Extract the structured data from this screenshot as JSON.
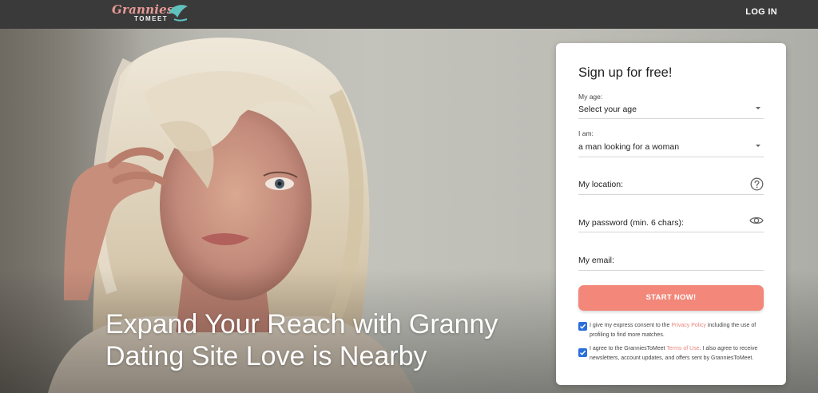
{
  "header": {
    "logo_main": "Grannies",
    "logo_sub": "TOMEET",
    "login_label": "LOG IN"
  },
  "hero": {
    "headline_line1": "Expand Your Reach with Granny",
    "headline_line2": "Dating Site Love is Nearby"
  },
  "signup": {
    "title": "Sign up for free!",
    "age_label": "My age:",
    "age_value": "Select your age",
    "iam_label": "I am:",
    "iam_value": "a man looking for a woman",
    "location_placeholder": "My location:",
    "password_placeholder": "My password (min. 6 chars):",
    "email_placeholder": "My email:",
    "submit_label": "START NOW!",
    "consent1_before": "I give my express consent to the ",
    "consent1_link": "Privacy Policy",
    "consent1_after": " including the use of profiling to find more matches.",
    "consent2_before": "I agree to the GranniesToMeet ",
    "consent2_link": "Terms of Use",
    "consent2_after": ". I also agree to receive newsletters, account updates, and offers sent by GranniesToMeet.",
    "consent1_checked": true,
    "consent2_checked": true
  },
  "colors": {
    "accent": "#f2877a",
    "checkbox": "#2a6fdb",
    "topbar": "#3a3a3a"
  }
}
